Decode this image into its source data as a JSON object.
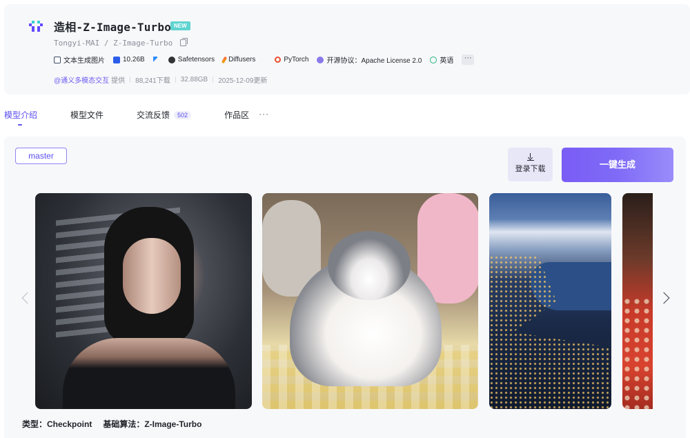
{
  "header": {
    "title": "造相-Z-Image-Turbo",
    "badge": "NEW",
    "org": "Tongyi-MAI",
    "path_sep": "/",
    "repo": "Z-Image-Turbo",
    "tags": [
      {
        "label": "文本生成图片",
        "icon": "text-to-image-icon"
      },
      {
        "label": "10.26B",
        "icon": "folder-icon"
      },
      {
        "label": "",
        "icon": "lightning-icon"
      },
      {
        "label": "Safetensors",
        "icon": "safetensors-icon"
      },
      {
        "label": "Diffusers",
        "icon": "diffusers-icon"
      },
      {
        "label": "PyTorch",
        "icon": "pytorch-icon"
      },
      {
        "label": "开源协议：Apache License 2.0",
        "icon": "license-icon"
      },
      {
        "label": "英语",
        "icon": "globe-icon"
      }
    ],
    "more": "···",
    "meta": {
      "provider": "@通义多模态交互",
      "provider_suffix": "提供",
      "downloads": "88,241下载",
      "size": "32.88GB",
      "updated": "2025-12-09更新"
    }
  },
  "tabs": [
    {
      "label": "模型介绍",
      "active": true
    },
    {
      "label": "模型文件"
    },
    {
      "label": "交流反馈",
      "count": "502"
    },
    {
      "label": "作品区"
    }
  ],
  "tabs_more": "···",
  "panel": {
    "branch": "master",
    "login_download": "登录下载",
    "generate": "一键生成",
    "gallery": [
      "portrait-image",
      "cat-image",
      "lake-town-image",
      "red-dress-image"
    ],
    "type_label": "类型：Checkpoint",
    "base_label": "基础算法：Z-Image-Turbo"
  },
  "colors": {
    "accent": "#5b4ef0",
    "badge": "#5fd4d0",
    "panel_bg": "#f7f8fa"
  }
}
